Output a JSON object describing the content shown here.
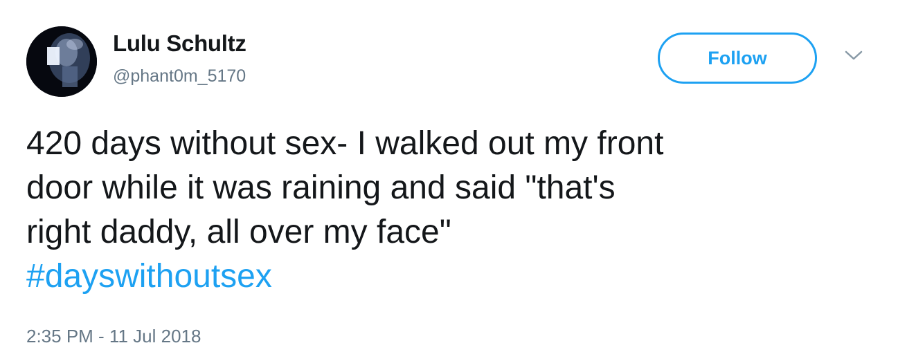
{
  "user": {
    "display_name": "Lulu Schultz",
    "handle": "@phant0m_5170"
  },
  "actions": {
    "follow_label": "Follow",
    "more_icon": "chevron-down-icon"
  },
  "tweet": {
    "lines": [
      "420 days without sex- I walked out my front",
      "door while it was raining and said \"that's",
      "right daddy, all over my face\""
    ],
    "hashtag": "#dayswithoutsex",
    "timestamp": "2:35 PM - 11 Jul 2018"
  },
  "colors": {
    "accent": "#1da1f2",
    "text": "#14171a",
    "secondary_text": "#657786"
  }
}
